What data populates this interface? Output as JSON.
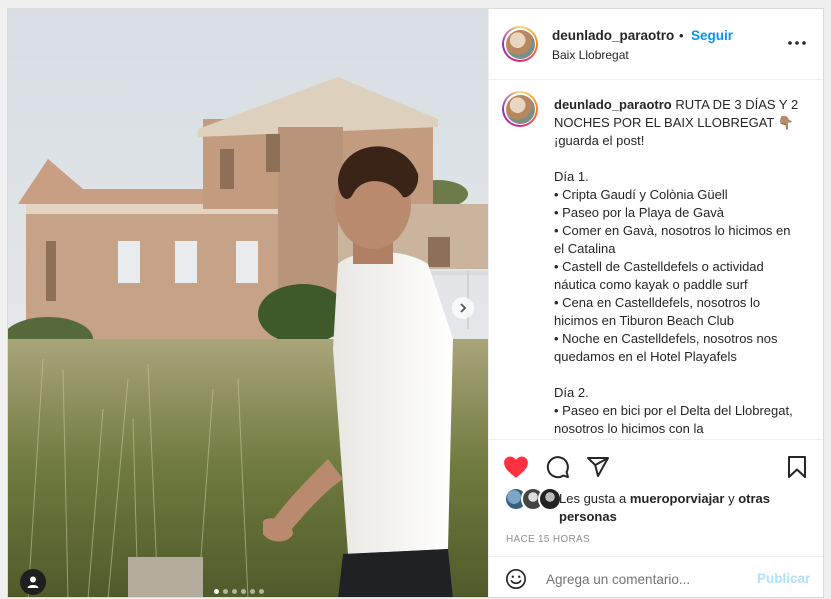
{
  "post": {
    "username": "deunlado_paraotro",
    "separator": "•",
    "follow_label": "Seguir",
    "location": "Baix Llobregat",
    "caption_user": "deunlado_paraotro",
    "caption": " RUTA DE 3 DÍAS Y 2 NOCHES POR EL BAIX LLOBREGAT 👇🏽 ¡guarda el post!\n\nDía 1.\n• Cripta Gaudí y Colònia Güell\n• Paseo por la Playa de Gavà\n• Comer en Gavà, nosotros lo hicimos en el Catalina\n• Castell de Castelldefels o actividad náutica como kayak o paddle surf\n• Cena en Castelldefels, nosotros lo hicimos en Tiburon Beach Club\n• Noche en Castelldefels, nosotros nos quedamos en el Hotel Playafels\n\nDía 2.\n• Paseo en bici por el Delta del Llobregat, nosotros lo hicimos con la",
    "likes_prefix": "Les gusta a ",
    "likes_user": "mueroporviajar",
    "likes_mid": " y ",
    "likes_others": "otras personas",
    "time_ago": "HACE 15 HORAS",
    "carousel_count": 6,
    "carousel_active": 0
  },
  "comment": {
    "placeholder": "Agrega un comentario...",
    "publish_label": "Publicar"
  },
  "icons": {
    "like": "heart-filled-icon",
    "comment": "comment-icon",
    "share": "paper-plane-icon",
    "save": "bookmark-icon",
    "more": "more-horizontal-icon",
    "next": "chevron-right-icon",
    "tag": "user-tag-icon",
    "emoji": "emoji-icon"
  },
  "colors": {
    "like": "#ff3040",
    "follow": "#0095f6",
    "publish_disabled": "#b2dffc",
    "muted": "#8e8e8e"
  }
}
